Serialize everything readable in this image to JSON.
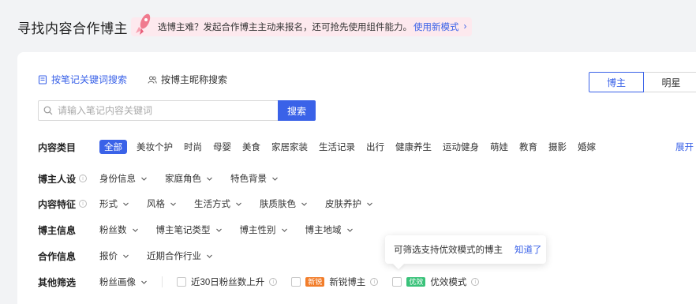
{
  "page": {
    "title": "寻找内容合作博主"
  },
  "promo": {
    "text": "选博主难？发起合作博主主动来报名，还可抢先使用组件能力。",
    "link": "使用新模式"
  },
  "tabs": [
    {
      "label": "按笔记关键词搜索",
      "active": true
    },
    {
      "label": "按博主昵称搜索",
      "active": false
    }
  ],
  "segment": {
    "blogger": "博主",
    "star": "明星"
  },
  "search": {
    "placeholder": "请输入笔记内容关键词",
    "button": "搜索"
  },
  "content_category": {
    "label": "内容类目",
    "items": [
      "全部",
      "美妆个护",
      "时尚",
      "母婴",
      "美食",
      "家居家装",
      "生活记录",
      "出行",
      "健康养生",
      "运动健身",
      "萌娃",
      "教育",
      "摄影",
      "婚嫁"
    ],
    "expand": "展开"
  },
  "persona": {
    "label": "博主人设",
    "options": [
      "身份信息",
      "家庭角色",
      "特色背景"
    ]
  },
  "features": {
    "label": "内容特征",
    "options": [
      "形式",
      "风格",
      "生活方式",
      "肤质肤色",
      "皮肤养护"
    ]
  },
  "blogger_info": {
    "label": "博主信息",
    "options": [
      "粉丝数",
      "博主笔记类型",
      "博主性别",
      "博主地域"
    ]
  },
  "cooperation": {
    "label": "合作信息",
    "options": [
      "报价",
      "近期合作行业"
    ]
  },
  "other": {
    "label": "其他筛选",
    "fans_profile": "粉丝画像",
    "rising": "近30日粉丝数上升",
    "new_tag": "新锐",
    "new_label": "新锐博主",
    "eff_tag": "优效",
    "eff_label": "优效模式"
  },
  "tooltip": {
    "text": "可筛选支持优效模式的博主",
    "ok": "知道了"
  },
  "colors": {
    "accent": "#3a62e8",
    "promo_bg": "#fde9ee",
    "new_tag": "#f27d2a",
    "eff_tag": "#3ac27a"
  }
}
